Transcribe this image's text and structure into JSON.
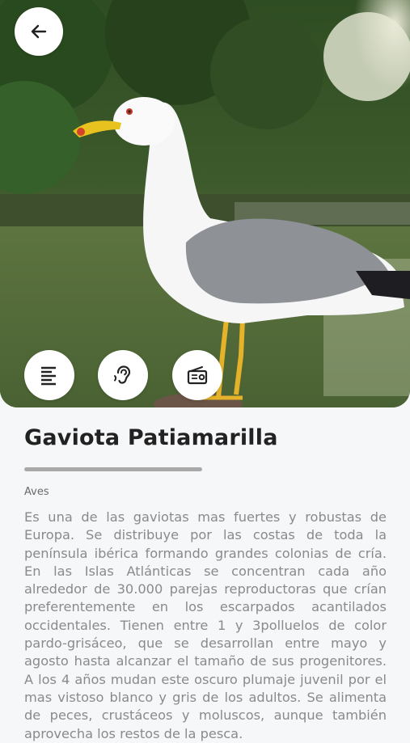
{
  "header": {
    "back_icon": "arrow-left-icon"
  },
  "actions": [
    {
      "icon": "text-align-left-icon"
    },
    {
      "icon": "ear-icon"
    },
    {
      "icon": "radio-icon"
    }
  ],
  "species": {
    "name": "Gaviota Patiamarilla",
    "category": "Aves",
    "audio_progress": 1.0,
    "description": "Es una de las gaviotas mas fuertes y robustas de Europa. Se distribuye por las costas de toda la península ibérica formando grandes colonias de cría. En las Islas Atlánticas se concentran cada año alrededor de 30.000 parejas reproductoras que crían preferentemente en los escarpados acantilados occidentales. Tienen entre 1 y 3polluelos de color pardo-grisáceo, que se desarrollan entre mayo y agosto hasta alcanzar el tamaño de sus progenitores. A los 4 años mudan este oscuro plumaje juvenil por el mas vistoso blanco y gris de los adultos. Se alimenta de peces, crustáceos y moluscos, aunque también aprovecha los restos de la pesca."
  },
  "colors": {
    "title": "#222222",
    "text": "#8a8a8a",
    "progress": "#a9a9a9"
  }
}
